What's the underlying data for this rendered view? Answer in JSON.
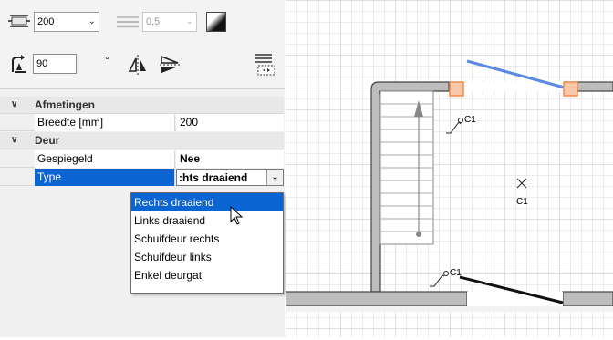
{
  "toolbar": {
    "width_value": "200",
    "thickness_value": "0,5",
    "angle_value": "90",
    "degree_symbol": "°"
  },
  "properties": {
    "categories": [
      {
        "label": "Afmetingen"
      },
      {
        "label": "Deur"
      }
    ],
    "rows": [
      {
        "label": "Breedte [mm]",
        "value": "200"
      },
      {
        "label": "Gespiegeld",
        "value": "Nee"
      },
      {
        "label": "Type",
        "value": ":hts draaiend"
      }
    ]
  },
  "dropdown": {
    "options": [
      "Rechts draaiend",
      "Links draaiend",
      "Schuifdeur rechts",
      "Schuifdeur links",
      "Enkel deurgat"
    ],
    "selected": "Rechts draaiend"
  },
  "drawing": {
    "labels": [
      "C1",
      "C1",
      "C1"
    ]
  },
  "colors": {
    "selection": "#0a64d2",
    "wall": "#bdbdbd",
    "door_selected": "#5b8be0",
    "handle": "#f08a4b"
  }
}
